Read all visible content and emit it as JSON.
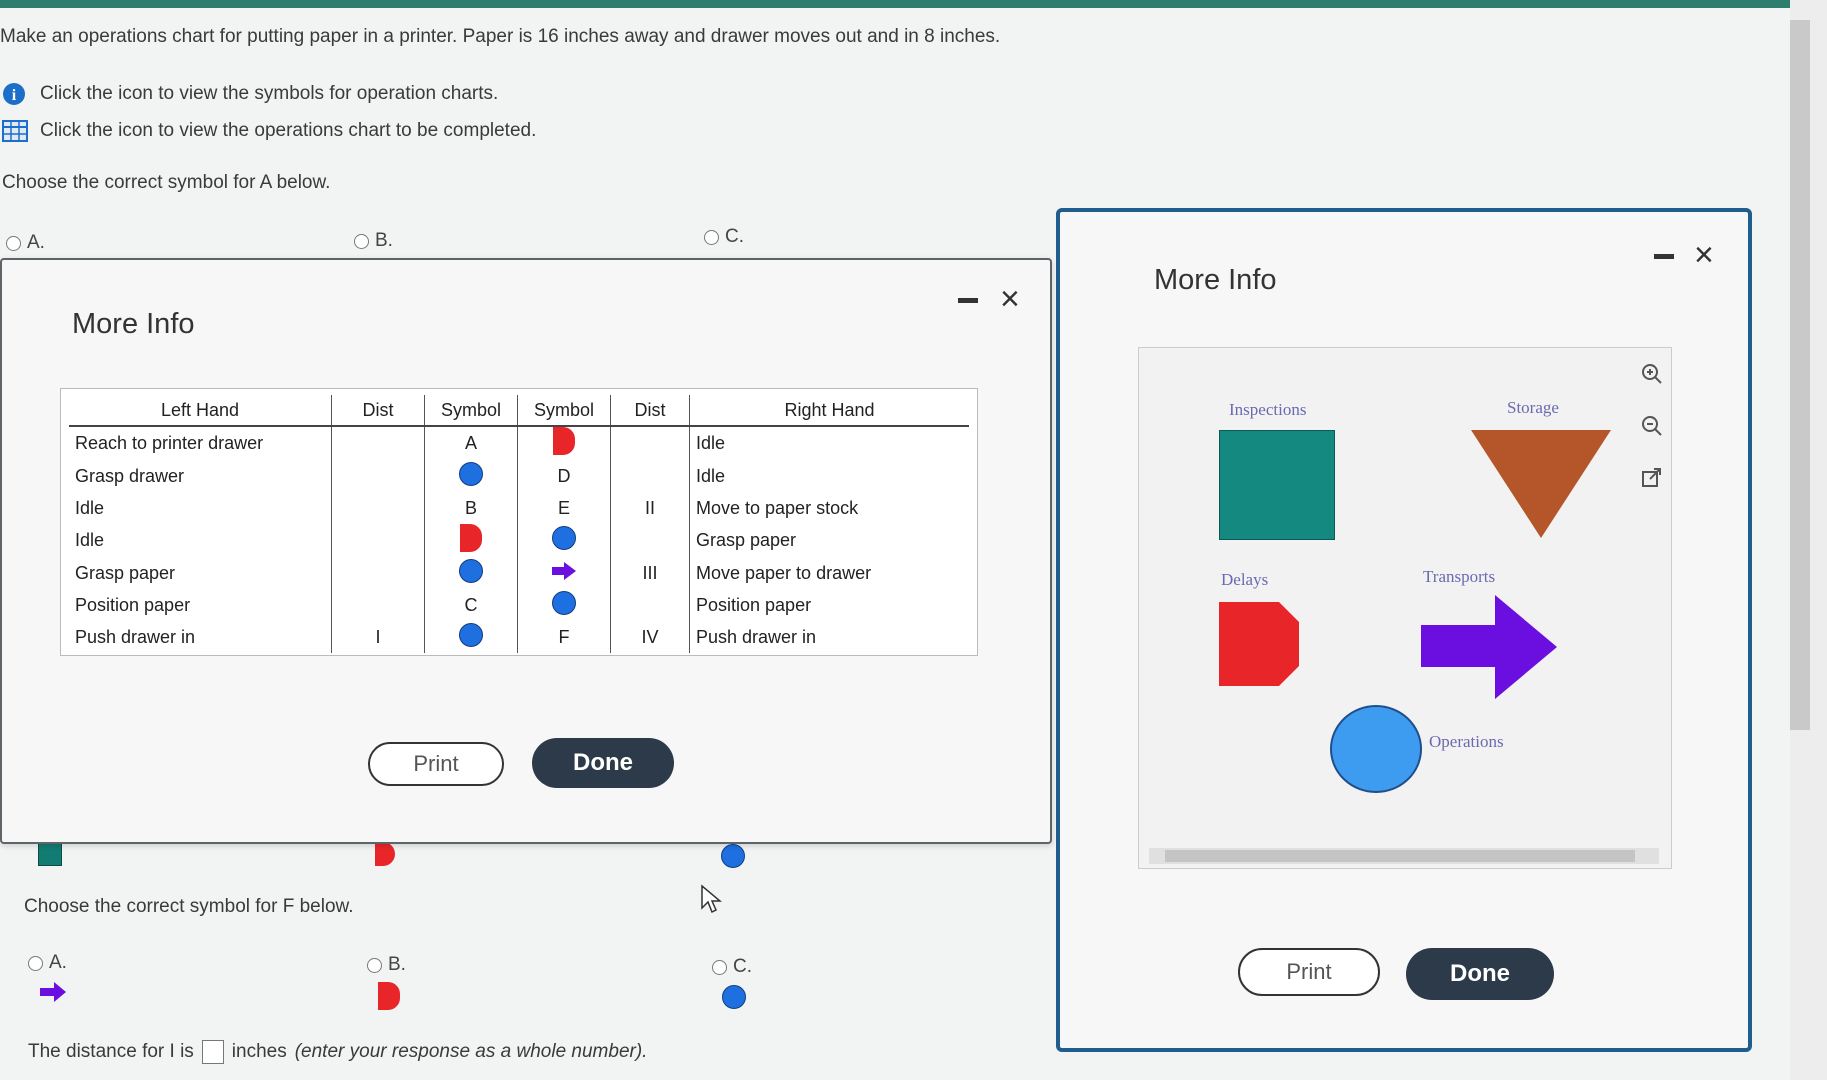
{
  "question": {
    "prompt": "Make an operations chart for putting paper in a printer. Paper is 16 inches away and drawer moves out and in 8 inches.",
    "info_link": "Click the icon to view the symbols for operation charts.",
    "chart_link": "Click the icon to view the operations chart to be completed.",
    "part_a_prompt": "Choose the correct symbol for A below.",
    "part_a_options": [
      "A.",
      "B.",
      "C."
    ],
    "part_f_prompt": "Choose the correct symbol for F below.",
    "part_f_options": [
      "A.",
      "B.",
      "C."
    ],
    "distance_prefix": "The distance for I is",
    "distance_suffix": "inches",
    "distance_hint": "(enter your response as a whole number)."
  },
  "modal_chart": {
    "title": "More Info",
    "headers": [
      "Left Hand",
      "Dist",
      "Symbol",
      "Symbol",
      "Dist",
      "Right Hand"
    ],
    "rows": [
      {
        "left": "Reach to printer drawer",
        "dist_l": "",
        "sym_l": "A",
        "sym_r": "delay",
        "dist_r": "",
        "right": "Idle"
      },
      {
        "left": "Grasp drawer",
        "dist_l": "",
        "sym_l": "operation",
        "sym_r": "D",
        "dist_r": "",
        "right": "Idle"
      },
      {
        "left": "Idle",
        "dist_l": "",
        "sym_l": "B",
        "sym_r": "E",
        "dist_r": "II",
        "right": "Move to paper stock"
      },
      {
        "left": "Idle",
        "dist_l": "",
        "sym_l": "delay",
        "sym_r": "operation",
        "dist_r": "",
        "right": "Grasp paper"
      },
      {
        "left": "Grasp paper",
        "dist_l": "",
        "sym_l": "operation",
        "sym_r": "transport",
        "dist_r": "III",
        "right": "Move paper to drawer"
      },
      {
        "left": "Position paper",
        "dist_l": "",
        "sym_l": "C",
        "sym_r": "operation",
        "dist_r": "",
        "right": "Position paper"
      },
      {
        "left": "Push drawer in",
        "dist_l": "I",
        "sym_l": "operation",
        "sym_r": "F",
        "dist_r": "IV",
        "right": "Push drawer in"
      }
    ],
    "print_label": "Print",
    "done_label": "Done"
  },
  "modal_legend": {
    "title": "More Info",
    "inspections": "Inspections",
    "storage": "Storage",
    "delays": "Delays",
    "transports": "Transports",
    "operations": "Operations",
    "print_label": "Print",
    "done_label": "Done"
  },
  "colors": {
    "operation": "#1e6fe0",
    "delay": "#e8262a",
    "inspection": "#137c72",
    "transport": "#6a0fe0",
    "storage": "#b5562a"
  }
}
